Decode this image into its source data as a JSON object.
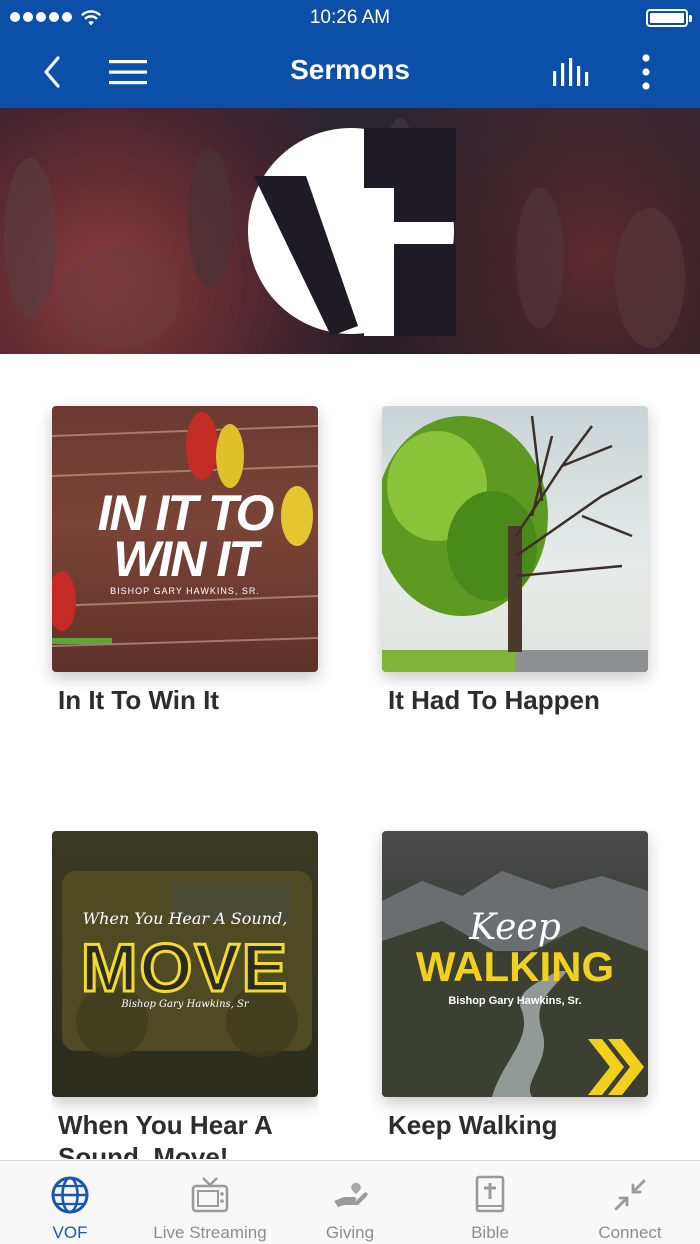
{
  "status_bar": {
    "time": "10:26 AM"
  },
  "nav": {
    "title": "Sermons"
  },
  "colors": {
    "brand": "#0b4fa8",
    "active_tab": "#1a56b0",
    "inactive_tab": "#8e8e8e",
    "title_text": "#2d2d2d"
  },
  "sermons": [
    {
      "title": "In It To Win It",
      "art_line1": "IN IT TO",
      "art_line2": "WIN IT",
      "art_credit": "BISHOP GARY HAWKINS, SR."
    },
    {
      "title": "It Had To Happen"
    },
    {
      "title": "When You Hear A Sound, Move!",
      "art_script": "When You Hear A Sound,",
      "art_main": "MOVE",
      "art_credit": "Bishop Gary Hawkins, Sr"
    },
    {
      "title": "Keep Walking",
      "art_script": "Keep",
      "art_main": "WALKING",
      "art_credit": "Bishop Gary Hawkins, Sr."
    }
  ],
  "tabs": [
    {
      "label": "VOF",
      "icon": "globe-icon",
      "active": true
    },
    {
      "label": "Live Streaming",
      "icon": "tv-icon",
      "active": false
    },
    {
      "label": "Giving",
      "icon": "giving-hand-icon",
      "active": false
    },
    {
      "label": "Bible",
      "icon": "bible-icon",
      "active": false
    },
    {
      "label": "Connect",
      "icon": "connect-arrows-icon",
      "active": false
    }
  ]
}
